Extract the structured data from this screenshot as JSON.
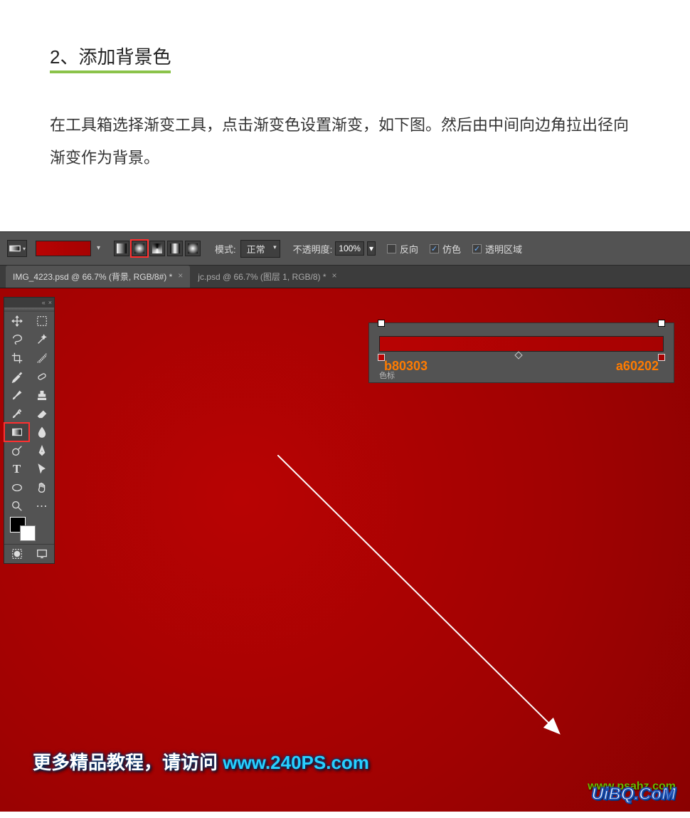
{
  "article": {
    "heading": "2、添加背景色",
    "body": "在工具箱选择渐变工具，点击渐变色设置渐变，如下图。然后由中间向边角拉出径向渐变作为背景。"
  },
  "options": {
    "mode_label": "模式:",
    "mode_value": "正常",
    "opacity_label": "不透明度:",
    "opacity_value": "100%",
    "reverse": "反向",
    "dither": "仿色",
    "transparency": "透明区域"
  },
  "tabs": {
    "tab1": "IMG_4223.psd @ 66.7% (背景, RGB/8#) *",
    "tab2": "jc.psd @ 66.7% (图层 1, RGB/8) *"
  },
  "gradient": {
    "left_color": "b80303",
    "right_color": "a60202",
    "footer": "色标"
  },
  "watermark": {
    "text_prefix": "更多精品教程，请访问 ",
    "link": "www.240PS.com",
    "psahz": "www.psahz.com",
    "uibq": "UiBQ.CoM"
  }
}
